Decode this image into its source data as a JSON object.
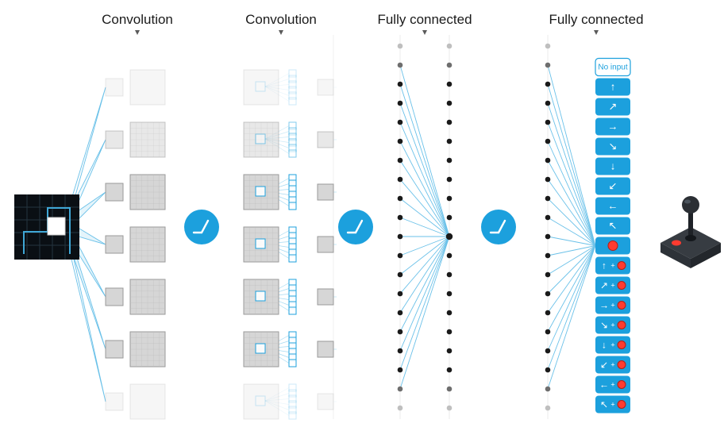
{
  "labels": {
    "conv1": "Convolution",
    "conv2": "Convolution",
    "fc1": "Fully connected",
    "fc2": "Fully connected",
    "noinput": "No input"
  },
  "actions": {
    "arrows": [
      "↑",
      "↗",
      "→",
      "↘",
      "↓",
      "↙",
      "←",
      "↖"
    ],
    "fire": "●",
    "plus": "+"
  },
  "colors": {
    "accent": "#1ca0dd",
    "boxFill": "#d6d6d6",
    "boxStroke": "#9a9a9a",
    "dotDark": "#1a1a1a",
    "dotMid": "#6e6e6e",
    "dotLight": "#bfbfbf",
    "fire": "#ff3b30",
    "joyBody": "#373c42",
    "joyTop": "#2b2f34"
  },
  "layout": {
    "conv1_rows": 7,
    "conv2_rows": 7,
    "fc_dots": 20,
    "outputs": 18
  }
}
